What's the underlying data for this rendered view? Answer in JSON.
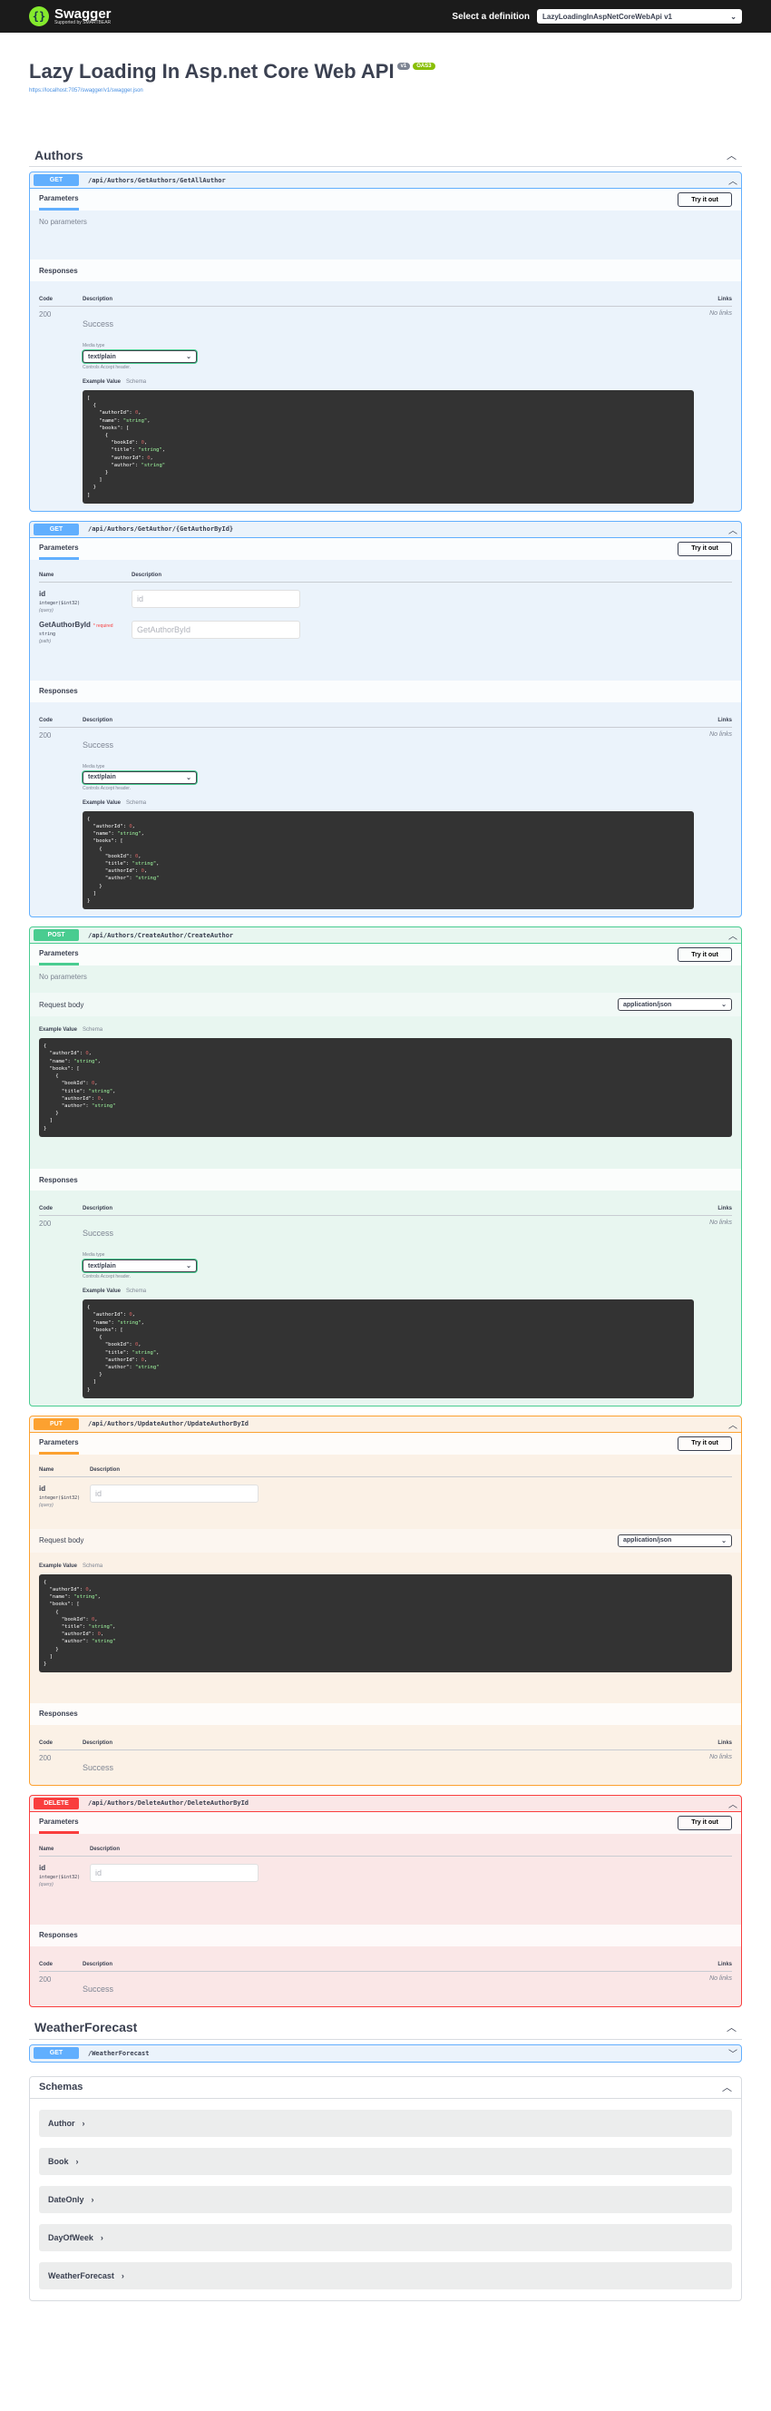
{
  "topbar": {
    "logo_title": "Swagger",
    "logo_sub": "Supported by SMARTBEAR",
    "definition_label": "Select a definition",
    "definition_value": "LazyLoadingInAspNetCoreWebApi v1"
  },
  "info": {
    "title": "Lazy Loading In Asp.net Core Web API",
    "version": "v1",
    "oas": "OAS3",
    "url": "https://localhost:7057/swagger/v1/swagger.json"
  },
  "common": {
    "parameters": "Parameters",
    "try": "Try it out",
    "no_params": "No parameters",
    "responses": "Responses",
    "code": "Code",
    "description": "Description",
    "links": "Links",
    "name": "Name",
    "success": "Success",
    "no_links": "No links",
    "status_200": "200",
    "media_type": "Media type",
    "media_value": "text/plain",
    "media_note": "Controls Accept header.",
    "example_value": "Example Value",
    "schema": "Schema",
    "request_body": "Request body",
    "content_type": "application/json"
  },
  "tags": {
    "authors": "Authors",
    "weather": "WeatherForecast"
  },
  "ops": {
    "get_all": {
      "method": "GET",
      "path": "/api/Authors/GetAuthors/GetAllAuthor"
    },
    "get_by_id": {
      "method": "GET",
      "path": "/api/Authors/GetAuthor/{GetAuthorById}",
      "p1_name": "id",
      "p1_type": "integer($int32)",
      "p1_in": "(query)",
      "p1_placeholder": "id",
      "p2_name": "GetAuthorById",
      "p2_required": "* required",
      "p2_type": "string",
      "p2_in": "(path)",
      "p2_placeholder": "GetAuthorById"
    },
    "create": {
      "method": "POST",
      "path": "/api/Authors/CreateAuthor/CreateAuthor"
    },
    "update": {
      "method": "PUT",
      "path": "/api/Authors/UpdateAuthor/UpdateAuthorById",
      "p1_name": "id",
      "p1_type": "integer($int32)",
      "p1_in": "(query)",
      "p1_placeholder": "id"
    },
    "delete": {
      "method": "DELETE",
      "path": "/api/Authors/DeleteAuthor/DeleteAuthorById",
      "p1_name": "id",
      "p1_type": "integer($int32)",
      "p1_in": "(query)",
      "p1_placeholder": "id"
    },
    "weather": {
      "method": "GET",
      "path": "/WeatherForecast"
    }
  },
  "schemas": {
    "title": "Schemas",
    "models": [
      "Author",
      "Book",
      "DateOnly",
      "DayOfWeek",
      "WeatherForecast"
    ]
  },
  "colors": {
    "get": "#61affe",
    "post": "#49cc90",
    "put": "#fca130",
    "delete": "#f93e3e"
  },
  "icons": {
    "collapse": "chevron-up-icon",
    "expand": "chevron-down-icon",
    "model_arrow": "chevron-right-icon"
  }
}
